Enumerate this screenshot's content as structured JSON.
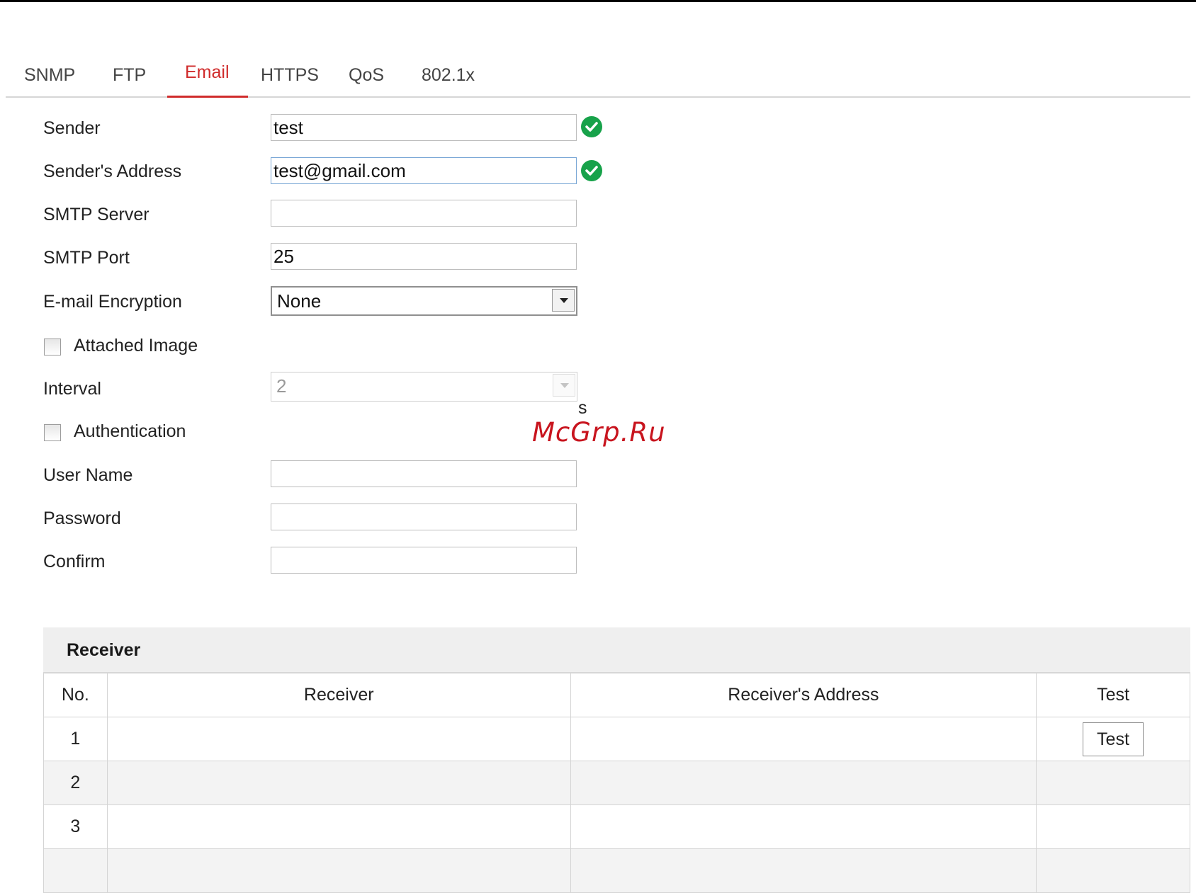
{
  "tabs": [
    {
      "label": "SNMP"
    },
    {
      "label": "FTP"
    },
    {
      "label": "Email",
      "active": true
    },
    {
      "label": "HTTPS"
    },
    {
      "label": "QoS"
    },
    {
      "label": "802.1x"
    }
  ],
  "form": {
    "sender": {
      "label": "Sender",
      "value": "test"
    },
    "sender_address": {
      "label": "Sender's Address",
      "value": "test@gmail.com"
    },
    "smtp_server": {
      "label": "SMTP Server",
      "value": ""
    },
    "smtp_port": {
      "label": "SMTP Port",
      "value": "25"
    },
    "encryption": {
      "label": "E-mail Encryption",
      "value": "None"
    },
    "attached_image": {
      "label": "Attached Image",
      "checked": false
    },
    "interval": {
      "label": "Interval",
      "value": "2",
      "unit": "s"
    },
    "authentication": {
      "label": "Authentication",
      "checked": false
    },
    "user_name": {
      "label": "User Name",
      "value": ""
    },
    "password": {
      "label": "Password",
      "value": ""
    },
    "confirm": {
      "label": "Confirm",
      "value": ""
    }
  },
  "receiver": {
    "title": "Receiver",
    "columns": [
      "No.",
      "Receiver",
      "Receiver's Address",
      "Test"
    ],
    "rows": [
      {
        "no": "1",
        "receiver": "",
        "address": "",
        "test_button": "Test"
      },
      {
        "no": "2",
        "receiver": "",
        "address": ""
      },
      {
        "no": "3",
        "receiver": "",
        "address": ""
      },
      {
        "no": "",
        "receiver": "",
        "address": ""
      }
    ]
  },
  "watermark": "McGrp.Ru",
  "colors": {
    "accent": "#d02b2b",
    "valid": "#17a24a"
  }
}
